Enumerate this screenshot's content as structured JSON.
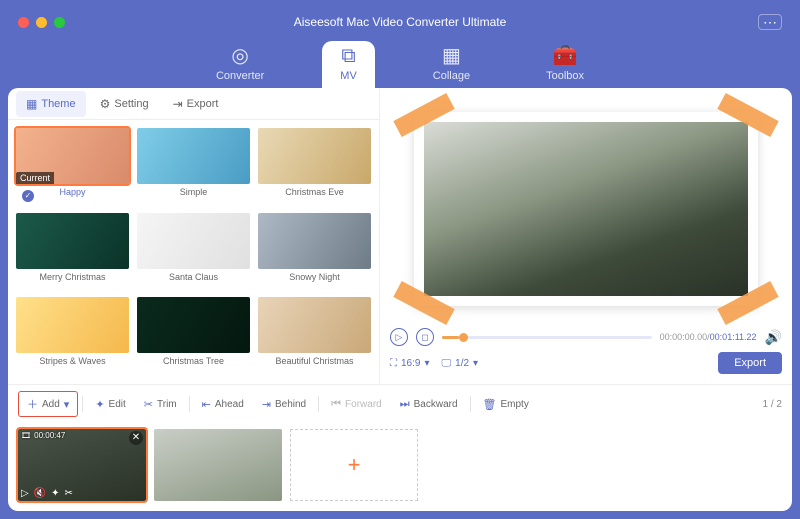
{
  "window": {
    "title": "Aiseesoft Mac Video Converter Ultimate"
  },
  "nav": {
    "items": [
      {
        "label": "Converter",
        "active": false
      },
      {
        "label": "MV",
        "active": true
      },
      {
        "label": "Collage",
        "active": false
      },
      {
        "label": "Toolbox",
        "active": false
      }
    ]
  },
  "subtabs": {
    "theme": "Theme",
    "setting": "Setting",
    "export": "Export"
  },
  "themes": {
    "current_badge": "Current",
    "items": [
      {
        "label": "Happy",
        "selected": true
      },
      {
        "label": "Simple"
      },
      {
        "label": "Christmas Eve"
      },
      {
        "label": "Merry Christmas"
      },
      {
        "label": "Santa Claus"
      },
      {
        "label": "Snowy Night"
      },
      {
        "label": "Stripes & Waves"
      },
      {
        "label": "Christmas Tree"
      },
      {
        "label": "Beautiful Christmas"
      }
    ]
  },
  "preview": {
    "time_current": "00:00:00.00",
    "time_total": "00:01:11.22",
    "aspect": "16:9",
    "screen_count": "1/2",
    "export_label": "Export"
  },
  "toolbar": {
    "add": "Add",
    "edit": "Edit",
    "trim": "Trim",
    "ahead": "Ahead",
    "behind": "Behind",
    "forward": "Forward",
    "backward": "Backward",
    "empty": "Empty",
    "pager": "1 / 2"
  },
  "clips": [
    {
      "duration": "00:00:47"
    }
  ],
  "drop": {
    "plus": "+"
  }
}
